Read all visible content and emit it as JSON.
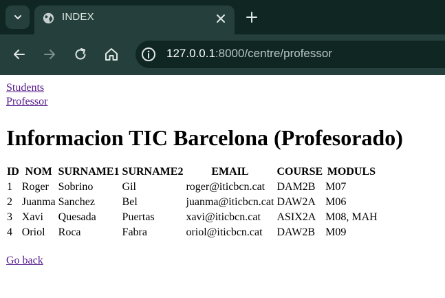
{
  "browser": {
    "tab": {
      "title": "INDEX"
    },
    "address": {
      "host": "127.0.0.1",
      "path": ":8000/centre/professor"
    }
  },
  "nav_links": [
    {
      "label": "Students"
    },
    {
      "label": "Professor"
    }
  ],
  "page_title": "Informacion TIC Barcelona (Profesorado)",
  "table": {
    "headers": [
      "ID",
      "NOM",
      "SURNAME1",
      "SURNAME2",
      "EMAIL",
      "COURSE",
      "MODULS"
    ],
    "rows": [
      [
        "1",
        "Roger",
        "Sobrino",
        "Gil",
        "roger@iticbcn.cat",
        "DAM2B",
        "M07"
      ],
      [
        "2",
        "Juanma",
        "Sanchez",
        "Bel",
        "juanma@iticbcn.cat",
        "DAW2A",
        "M06"
      ],
      [
        "3",
        "Xavi",
        "Quesada",
        "Puertas",
        "xavi@iticbcn.cat",
        "ASIX2A",
        "M08, MAH"
      ],
      [
        "4",
        "Oriol",
        "Roca",
        "Fabra",
        "oriol@iticbcn.cat",
        "DAW2B",
        "M09"
      ]
    ]
  },
  "footer_link": {
    "label": "Go back"
  },
  "colors": {
    "chrome_dark": "#0f2623",
    "chrome_light": "#25403c",
    "visited_link": "#551a8b"
  }
}
